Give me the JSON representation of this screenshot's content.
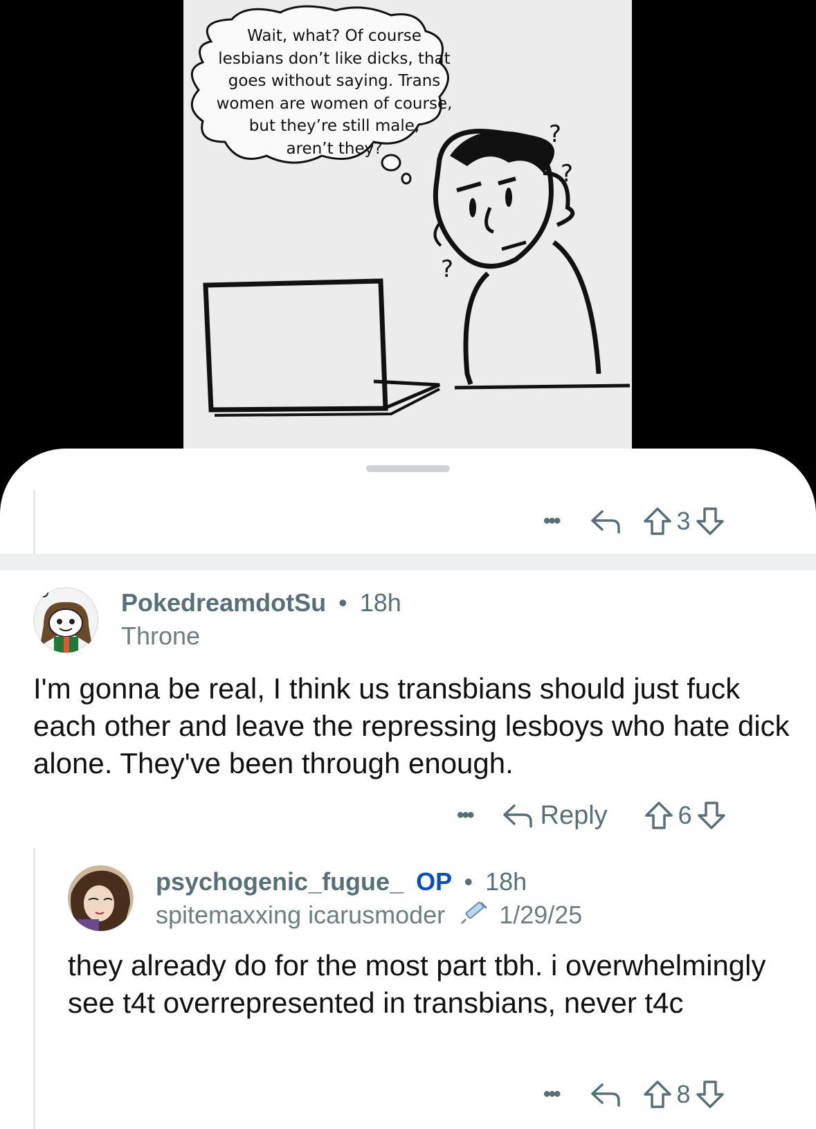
{
  "comic": {
    "thought_bubble": "Wait, what? Of course lesbians don’t like dicks, that goes without saying. Trans women are women of course, but they’re still male, aren’t they?",
    "thought_lines": [
      "Wait, what? Of course",
      "lesbians don’t like dicks, that",
      "goes without saying. Trans",
      "women are women of course,",
      "but they’re still male,",
      "aren’t they?"
    ],
    "question_marks": [
      "?",
      "?",
      "?"
    ]
  },
  "post_actions": {
    "more": "•••",
    "upvotes": "3"
  },
  "comments": [
    {
      "username": "PokedreamdotSu",
      "separator": "•",
      "time": "18h",
      "flair": "Throne",
      "body": "I'm gonna be real, I think us transbians should just fuck each other and leave the repressing lesboys who hate dick alone. They've been through enough.",
      "more": "•••",
      "reply_label": "Reply",
      "upvotes": "6"
    },
    {
      "username": "psychogenic_fugue_",
      "op_badge": "OP",
      "separator": "•",
      "time": "18h",
      "flair": "spitemaxxing icarusmoder",
      "flair_icon": "syringe-icon",
      "flair_date": "1/29/25",
      "body": "they already do for the most part tbh. i overwhelmingly see t4t overrepresented in transbians, never t4c",
      "more": "•••",
      "upvotes": "8"
    }
  ]
}
